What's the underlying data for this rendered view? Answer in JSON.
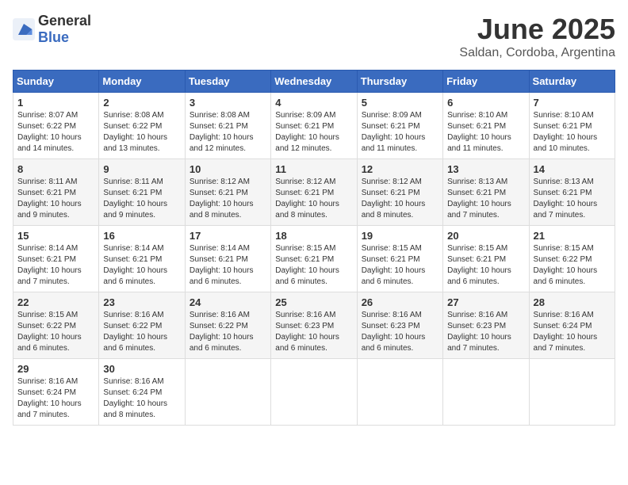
{
  "logo": {
    "general": "General",
    "blue": "Blue"
  },
  "title": "June 2025",
  "subtitle": "Saldan, Cordoba, Argentina",
  "headers": [
    "Sunday",
    "Monday",
    "Tuesday",
    "Wednesday",
    "Thursday",
    "Friday",
    "Saturday"
  ],
  "weeks": [
    [
      {
        "day": "1",
        "sunrise": "8:07 AM",
        "sunset": "6:22 PM",
        "daylight": "10 hours and 14 minutes."
      },
      {
        "day": "2",
        "sunrise": "8:08 AM",
        "sunset": "6:22 PM",
        "daylight": "10 hours and 13 minutes."
      },
      {
        "day": "3",
        "sunrise": "8:08 AM",
        "sunset": "6:21 PM",
        "daylight": "10 hours and 12 minutes."
      },
      {
        "day": "4",
        "sunrise": "8:09 AM",
        "sunset": "6:21 PM",
        "daylight": "10 hours and 12 minutes."
      },
      {
        "day": "5",
        "sunrise": "8:09 AM",
        "sunset": "6:21 PM",
        "daylight": "10 hours and 11 minutes."
      },
      {
        "day": "6",
        "sunrise": "8:10 AM",
        "sunset": "6:21 PM",
        "daylight": "10 hours and 11 minutes."
      },
      {
        "day": "7",
        "sunrise": "8:10 AM",
        "sunset": "6:21 PM",
        "daylight": "10 hours and 10 minutes."
      }
    ],
    [
      {
        "day": "8",
        "sunrise": "8:11 AM",
        "sunset": "6:21 PM",
        "daylight": "10 hours and 9 minutes."
      },
      {
        "day": "9",
        "sunrise": "8:11 AM",
        "sunset": "6:21 PM",
        "daylight": "10 hours and 9 minutes."
      },
      {
        "day": "10",
        "sunrise": "8:12 AM",
        "sunset": "6:21 PM",
        "daylight": "10 hours and 8 minutes."
      },
      {
        "day": "11",
        "sunrise": "8:12 AM",
        "sunset": "6:21 PM",
        "daylight": "10 hours and 8 minutes."
      },
      {
        "day": "12",
        "sunrise": "8:12 AM",
        "sunset": "6:21 PM",
        "daylight": "10 hours and 8 minutes."
      },
      {
        "day": "13",
        "sunrise": "8:13 AM",
        "sunset": "6:21 PM",
        "daylight": "10 hours and 7 minutes."
      },
      {
        "day": "14",
        "sunrise": "8:13 AM",
        "sunset": "6:21 PM",
        "daylight": "10 hours and 7 minutes."
      }
    ],
    [
      {
        "day": "15",
        "sunrise": "8:14 AM",
        "sunset": "6:21 PM",
        "daylight": "10 hours and 7 minutes."
      },
      {
        "day": "16",
        "sunrise": "8:14 AM",
        "sunset": "6:21 PM",
        "daylight": "10 hours and 6 minutes."
      },
      {
        "day": "17",
        "sunrise": "8:14 AM",
        "sunset": "6:21 PM",
        "daylight": "10 hours and 6 minutes."
      },
      {
        "day": "18",
        "sunrise": "8:15 AM",
        "sunset": "6:21 PM",
        "daylight": "10 hours and 6 minutes."
      },
      {
        "day": "19",
        "sunrise": "8:15 AM",
        "sunset": "6:21 PM",
        "daylight": "10 hours and 6 minutes."
      },
      {
        "day": "20",
        "sunrise": "8:15 AM",
        "sunset": "6:21 PM",
        "daylight": "10 hours and 6 minutes."
      },
      {
        "day": "21",
        "sunrise": "8:15 AM",
        "sunset": "6:22 PM",
        "daylight": "10 hours and 6 minutes."
      }
    ],
    [
      {
        "day": "22",
        "sunrise": "8:15 AM",
        "sunset": "6:22 PM",
        "daylight": "10 hours and 6 minutes."
      },
      {
        "day": "23",
        "sunrise": "8:16 AM",
        "sunset": "6:22 PM",
        "daylight": "10 hours and 6 minutes."
      },
      {
        "day": "24",
        "sunrise": "8:16 AM",
        "sunset": "6:22 PM",
        "daylight": "10 hours and 6 minutes."
      },
      {
        "day": "25",
        "sunrise": "8:16 AM",
        "sunset": "6:23 PM",
        "daylight": "10 hours and 6 minutes."
      },
      {
        "day": "26",
        "sunrise": "8:16 AM",
        "sunset": "6:23 PM",
        "daylight": "10 hours and 6 minutes."
      },
      {
        "day": "27",
        "sunrise": "8:16 AM",
        "sunset": "6:23 PM",
        "daylight": "10 hours and 7 minutes."
      },
      {
        "day": "28",
        "sunrise": "8:16 AM",
        "sunset": "6:24 PM",
        "daylight": "10 hours and 7 minutes."
      }
    ],
    [
      {
        "day": "29",
        "sunrise": "8:16 AM",
        "sunset": "6:24 PM",
        "daylight": "10 hours and 7 minutes."
      },
      {
        "day": "30",
        "sunrise": "8:16 AM",
        "sunset": "6:24 PM",
        "daylight": "10 hours and 8 minutes."
      },
      null,
      null,
      null,
      null,
      null
    ]
  ],
  "labels": {
    "sunrise": "Sunrise:",
    "sunset": "Sunset:",
    "daylight": "Daylight:"
  }
}
